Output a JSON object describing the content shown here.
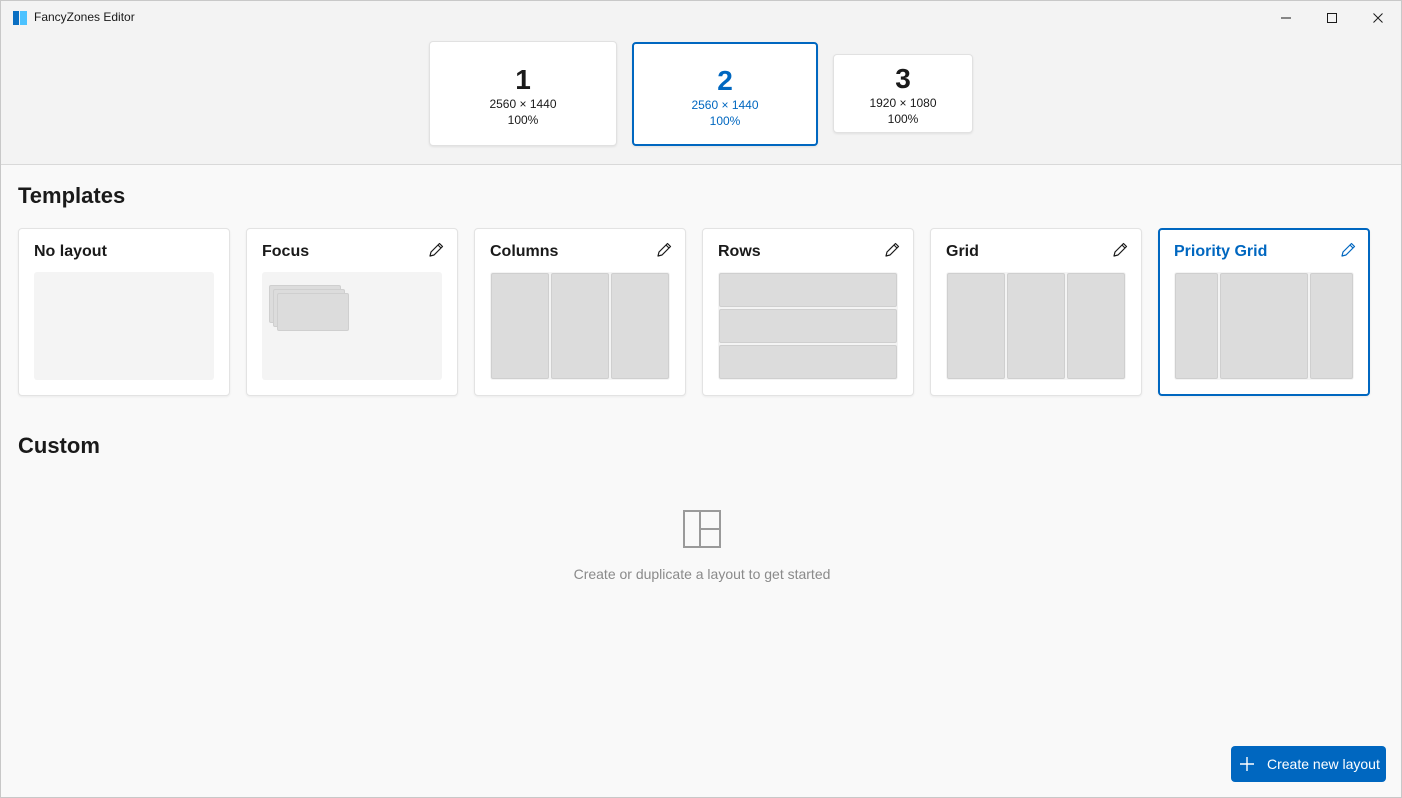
{
  "window": {
    "title": "FancyZones Editor"
  },
  "monitors": [
    {
      "number": "1",
      "resolution": "2560 × 1440",
      "scale": "100%",
      "selected": false
    },
    {
      "number": "2",
      "resolution": "2560 × 1440",
      "scale": "100%",
      "selected": true
    },
    {
      "number": "3",
      "resolution": "1920 × 1080",
      "scale": "100%",
      "selected": false
    }
  ],
  "templates": {
    "title": "Templates",
    "items": [
      {
        "label": "No layout",
        "editable": false,
        "selected": false
      },
      {
        "label": "Focus",
        "editable": true,
        "selected": false
      },
      {
        "label": "Columns",
        "editable": true,
        "selected": false
      },
      {
        "label": "Rows",
        "editable": true,
        "selected": false
      },
      {
        "label": "Grid",
        "editable": true,
        "selected": false
      },
      {
        "label": "Priority Grid",
        "editable": true,
        "selected": true
      }
    ]
  },
  "custom": {
    "title": "Custom",
    "empty_message": "Create or duplicate a layout to get started"
  },
  "actions": {
    "create_label": "Create new layout"
  },
  "colors": {
    "accent": "#0067c0",
    "zone": "#dcdcdc",
    "background": "#f9f9f9"
  },
  "icons": {
    "app": "fancyzones-icon",
    "minimize": "minimize-icon",
    "maximize": "maximize-icon",
    "close": "close-icon",
    "edit": "pencil-icon",
    "empty": "layout-icon",
    "add": "plus-icon"
  }
}
